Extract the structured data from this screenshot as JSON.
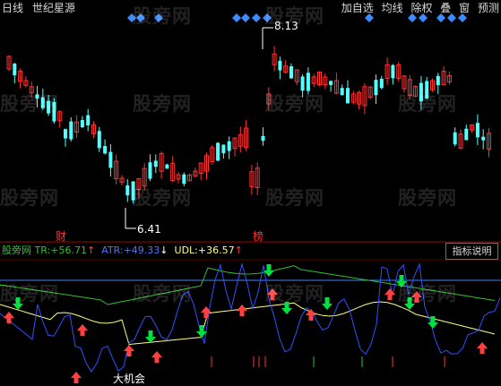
{
  "toolbar_left": [
    "日线",
    "世纪星源"
  ],
  "toolbar_right": [
    "加自选",
    "均线",
    "除权",
    "叠",
    "窗",
    "预测"
  ],
  "watermark": "股旁网",
  "price_high_label": "8.13",
  "price_low_label": "6.41",
  "event_labels": [
    "财",
    "榜"
  ],
  "indicator": {
    "source": "股旁网",
    "tr_label": "TR:",
    "tr_value": "+56.71",
    "atr_label": "ATR:",
    "atr_value": "+49.33",
    "udl_label": "UDL:",
    "udl_value": "+36.57",
    "button": "指标说明"
  },
  "bottom_label": "大机会",
  "colors": {
    "up": "#ff3232",
    "down": "#54ffff",
    "ma": "#ffffff",
    "diamond": "#3c8cff",
    "tr_line": "#30c030",
    "atr_line": "#3050ff",
    "udl_line": "#ffff80",
    "hline": "#4080ff",
    "up_arrow": "#ff4040",
    "down_arrow": "#00e040",
    "grid_red": "#a00000",
    "value_label": "#ffffff"
  },
  "icons": [
    "blue-diamond-icon",
    "up-arrow-icon",
    "down-arrow-icon"
  ]
}
